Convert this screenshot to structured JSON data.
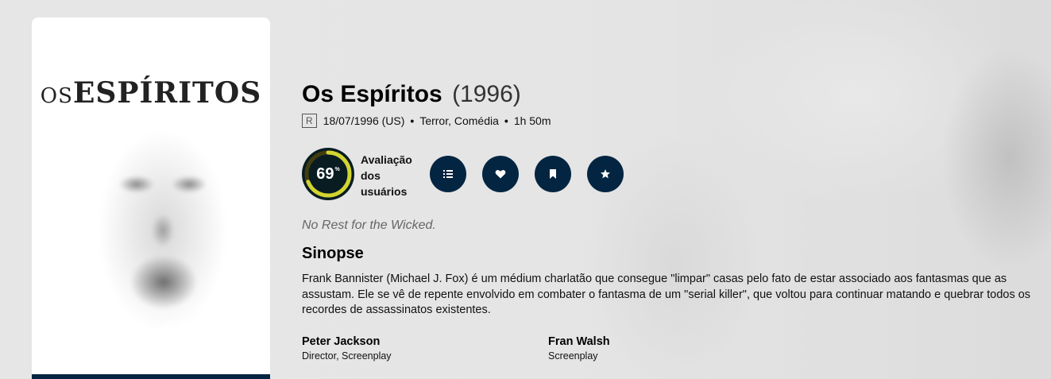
{
  "poster": {
    "title_small": "OS",
    "title_big": "ESPÍRITOS"
  },
  "movie": {
    "title": "Os Espíritos",
    "year": "(1996)",
    "certification": "R",
    "release_date": "18/07/1996 (US)",
    "genres": "Terror, Comédia",
    "runtime": "1h 50m",
    "tagline": "No Rest for the Wicked.",
    "overview_heading": "Sinopse",
    "overview": "Frank Bannister (Michael J. Fox) é um médium charlatão que consegue \"limpar\" casas pelo fato de estar associado aos fantasmas que as assustam. Ele se vê de repente envolvido em combater o fantasma de um \"serial killer\", que voltou para continuar matando e quebrar todos os recordes de assassinatos existentes."
  },
  "score": {
    "value": "69",
    "unit": "%",
    "fraction": 0.69,
    "label": "Avaliação dos usuários",
    "ring_color": "#d2d531",
    "track_color": "#423d0f"
  },
  "actions": [
    {
      "icon": "list-icon"
    },
    {
      "icon": "heart-icon"
    },
    {
      "icon": "bookmark-icon"
    },
    {
      "icon": "star-icon"
    }
  ],
  "crew": [
    {
      "name": "Peter Jackson",
      "role": "Director, Screenplay"
    },
    {
      "name": "Fran Walsh",
      "role": "Screenplay"
    }
  ],
  "colors": {
    "primary": "#032541",
    "score_bg": "#081c22"
  }
}
